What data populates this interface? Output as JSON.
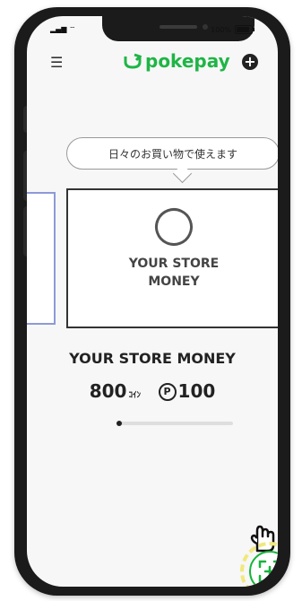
{
  "status": {
    "time": "",
    "battery": "100%"
  },
  "header": {
    "logo_text": "pokepay"
  },
  "bubble": {
    "text": "日々のお買い物で使えます"
  },
  "card": {
    "name_line1": "YOUR STORE",
    "name_line2": "MONEY"
  },
  "store": {
    "title": "YOUR STORE MONEY"
  },
  "balance": {
    "coins": "800",
    "coin_unit": "ｺｲﾝ",
    "points_symbol": "P",
    "points": "100"
  },
  "colors": {
    "brand": "#1fb546",
    "accent_card": "#ffe600"
  },
  "icons": {
    "menu": "hamburger-icon",
    "add": "plus-circle-icon",
    "ring": "ring-icon",
    "scan": "scan-icon"
  }
}
